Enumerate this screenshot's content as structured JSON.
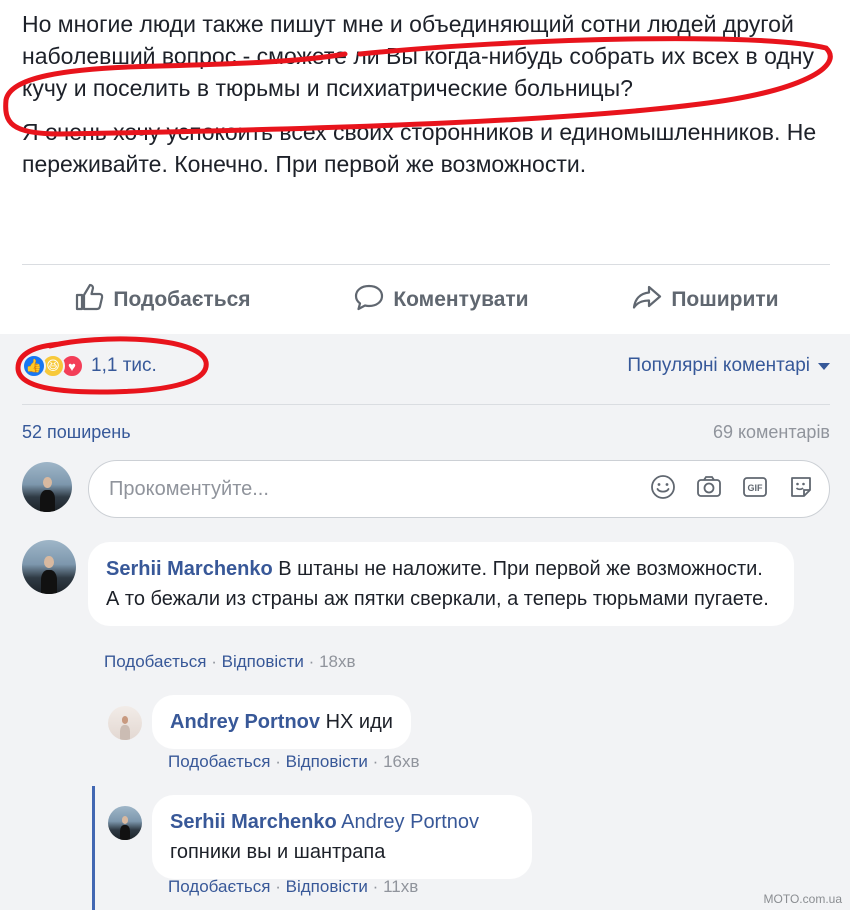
{
  "post": {
    "paragraph1": "Но многие люди также пишут мне и объединяющий сотни людей другой наболевший вопрос - сможете ли Вы когда-нибудь собрать их всех в одну кучу и поселить в тюрьмы и психиатрические больницы?",
    "paragraph2": "Я очень хочу успокоить всех своих сторонников и единомышленников. Не переживайте. Конечно. При первой же возможности."
  },
  "actions": {
    "like_label": "Подобається",
    "comment_label": "Коментувати",
    "share_label": "Поширити"
  },
  "reactions": {
    "count": "1,1 тис.",
    "sort_label": "Популярні коментарі"
  },
  "stats": {
    "shares": "52 поширень",
    "comments": "69 коментарів"
  },
  "composer": {
    "placeholder": "Прокоментуйте..."
  },
  "comments": [
    {
      "author": "Serhii Marchenko",
      "text": "В штаны не наложите. При первой же возможности. А то бежали из страны аж пятки сверкали, а теперь тюрьмами пугаете.",
      "like": "Подобається",
      "reply": "Відповісти",
      "time": "18хв"
    },
    {
      "author": "Andrey Portnov",
      "text": "НХ иди",
      "like": "Подобається",
      "reply": "Відповісти",
      "time": "16хв"
    },
    {
      "author": "Serhii Marchenko",
      "mention": "Andrey Portnov",
      "text": "гопники вы и шантрапа",
      "like": "Подобається",
      "reply": "Відповісти",
      "time": "11хв"
    }
  ],
  "meta_separator": "·",
  "watermark": "MOTO.com.ua",
  "colors": {
    "link_blue": "#385898",
    "annotation_red": "#e8141c",
    "comments_bg": "#f2f3f5"
  },
  "icons": [
    "thumbs-up-icon",
    "speech-bubble-icon",
    "share-arrow-icon",
    "like-reaction-icon",
    "haha-reaction-icon",
    "love-reaction-icon",
    "emoji-icon",
    "camera-icon",
    "gif-icon",
    "sticker-icon"
  ]
}
